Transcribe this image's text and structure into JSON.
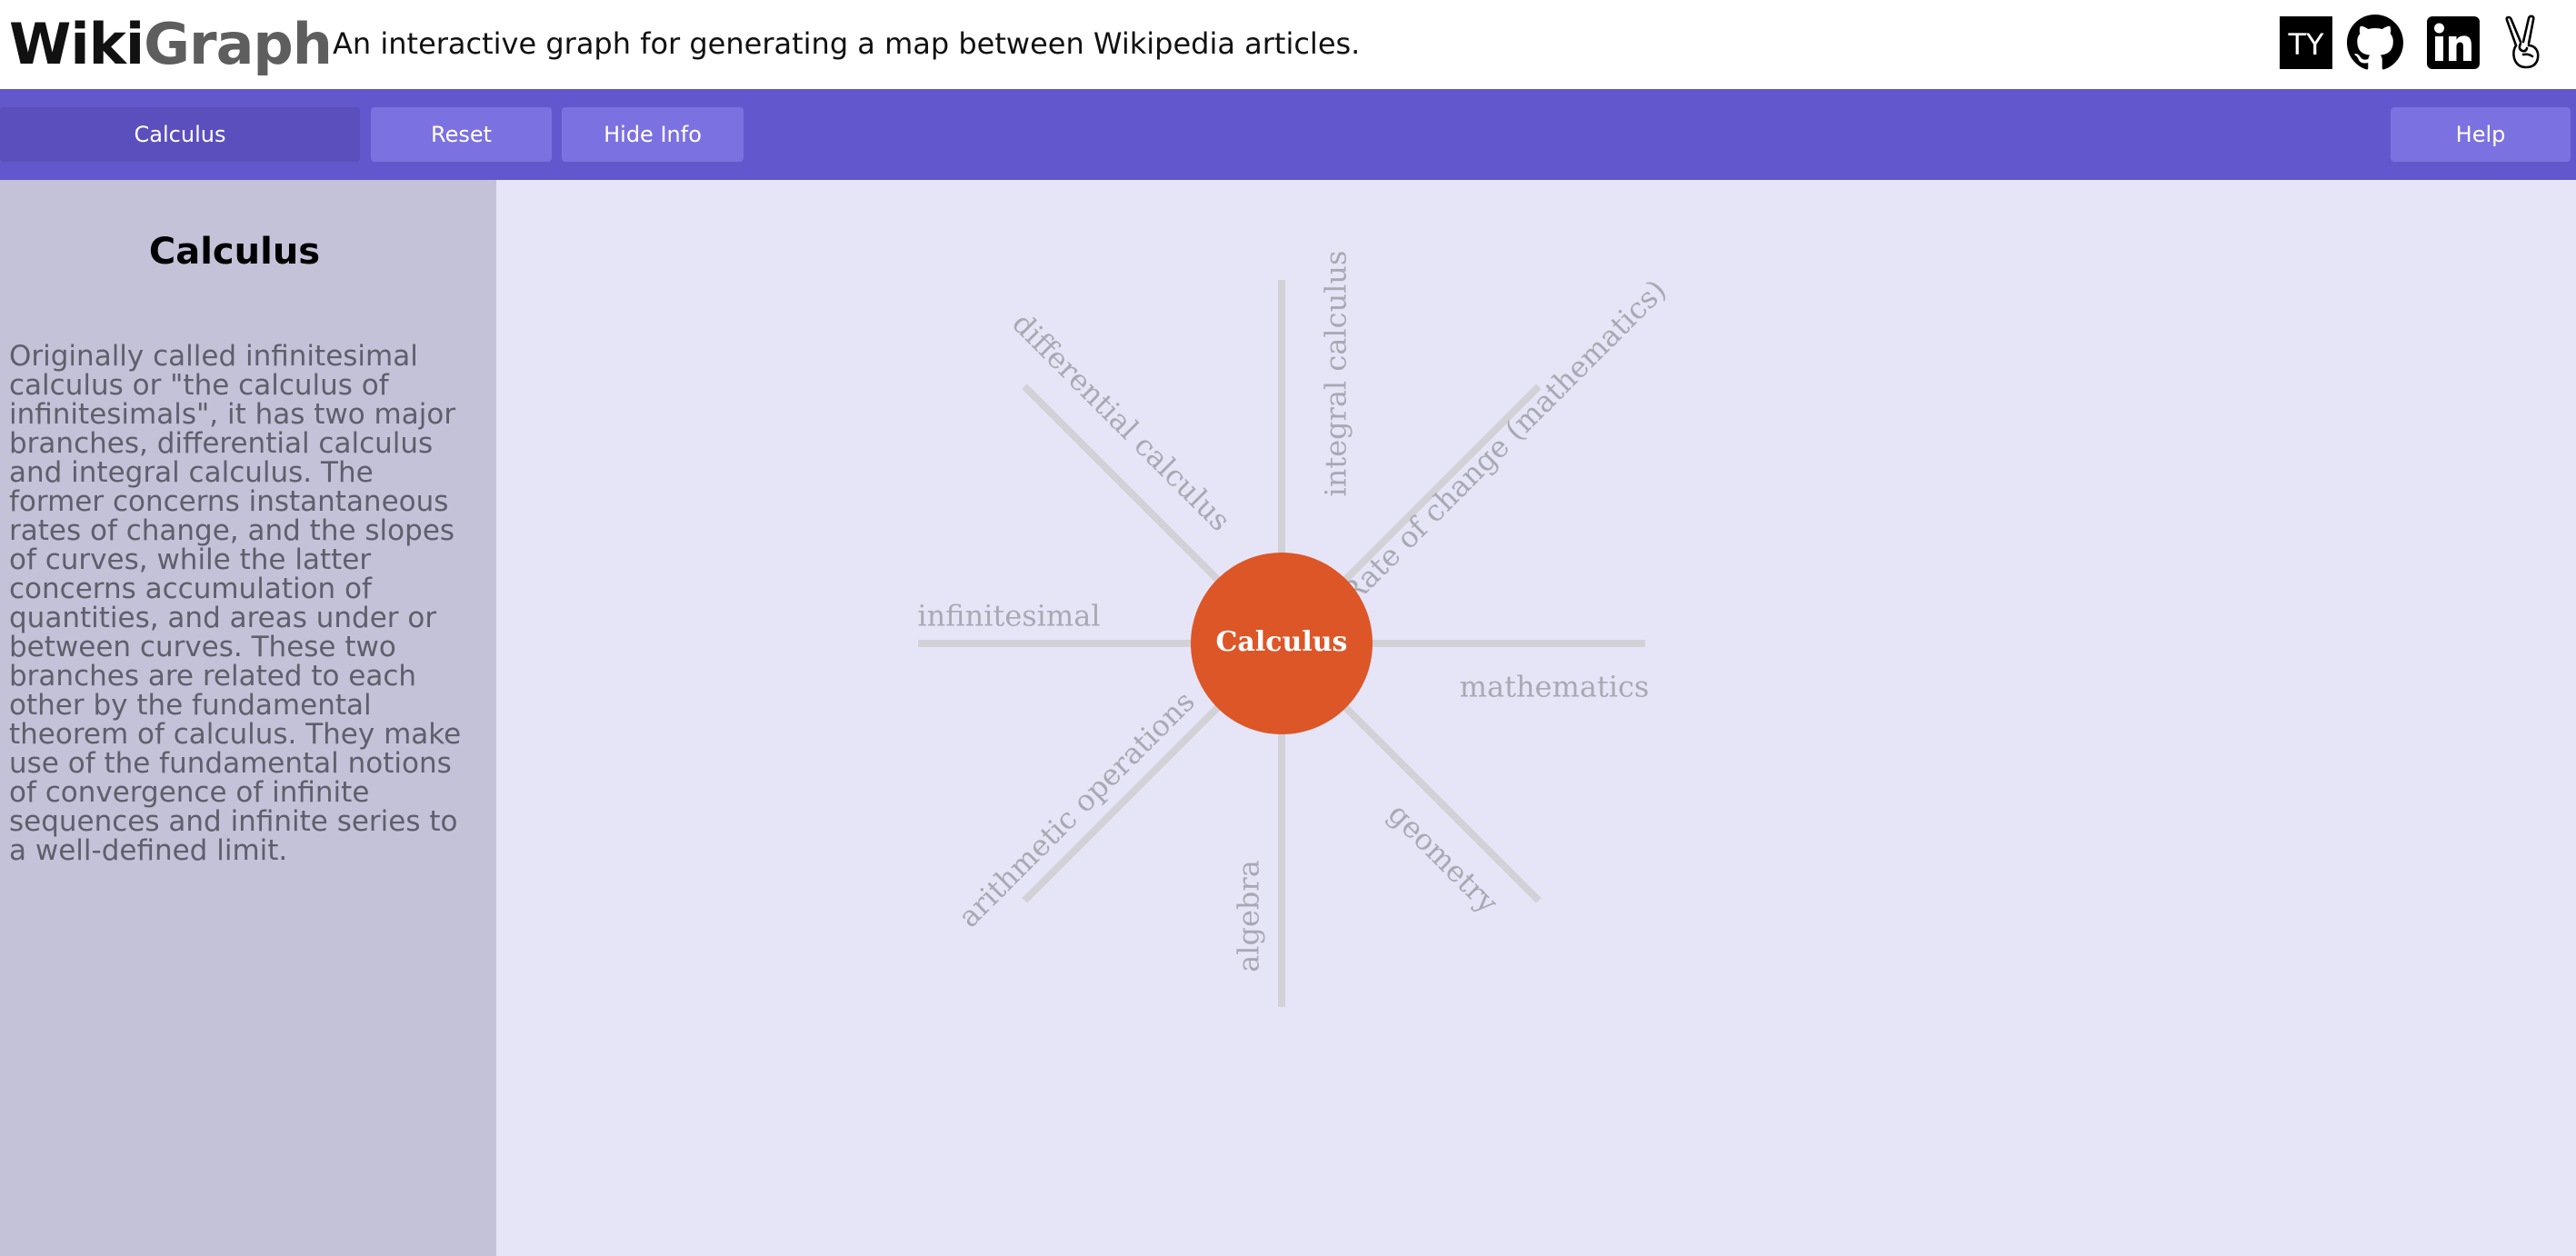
{
  "header": {
    "logo_part1": "Wiki",
    "logo_part2": "Graph",
    "tagline": "An interactive graph for generating a map between Wikipedia articles.",
    "social_icons": [
      "ty-logo-icon",
      "github-icon",
      "linkedin-icon",
      "peace-hand-icon"
    ],
    "ty_text": "TY"
  },
  "toolbar": {
    "search_label": "Calculus",
    "reset_label": "Reset",
    "hide_info_label": "Hide Info",
    "help_label": "Help"
  },
  "sidebar": {
    "title": "Calculus",
    "summary": "Originally called infinitesimal calculus or \"the calculus of infinitesimals\", it has two major branches, differential calculus and integral calculus. The former concerns instantaneous rates of change, and the slopes of curves, while the latter concerns accumulation of quantities, and areas under or between curves. These two branches are related to each other by the fundamental theorem of calculus. They make use of the fundamental notions of convergence of infinite sequences and infinite series to a well-defined limit."
  },
  "graph": {
    "center": "Calculus",
    "nodes": [
      "integral calculus",
      "Rate of change (mathematics)",
      "mathematics",
      "geometry",
      "algebra",
      "arithmetic operations",
      "infinitesimal",
      "differential calculus"
    ]
  },
  "colors": {
    "toolbar": "#6257cc",
    "button": "#7c71e0",
    "button_active": "#5a4fbc",
    "sidebar": "#c3c2d9",
    "graph_bg": "#e6e5f7",
    "center_node": "#dc5628"
  }
}
